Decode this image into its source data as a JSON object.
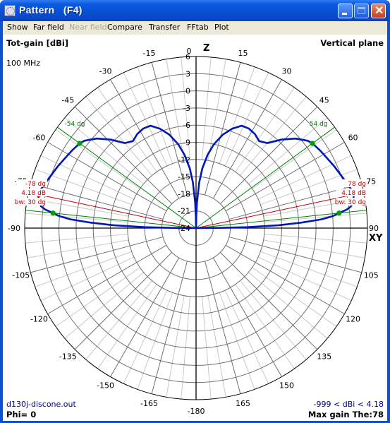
{
  "window": {
    "title": "Pattern   (F4)",
    "buttons": {
      "minimize": "minimize",
      "maximize": "maximize",
      "close": "close"
    }
  },
  "menu": [
    {
      "label": "Show",
      "enabled": true
    },
    {
      "label": "Far field",
      "enabled": true
    },
    {
      "label": "Near field",
      "enabled": false
    },
    {
      "label": "Compare",
      "enabled": true
    },
    {
      "label": "Transfer",
      "enabled": true
    },
    {
      "label": "FFtab",
      "enabled": true
    },
    {
      "label": "Plot",
      "enabled": true
    }
  ],
  "header": {
    "quantity": "Tot-gain [dBi]",
    "plane": "Vertical plane",
    "frequency": "100 MHz"
  },
  "footer": {
    "file": "d130j-discone.out",
    "phi": "Phi= 0",
    "range": "-999 < dBi < 4.18",
    "max_gain": "Max gain The:78"
  },
  "axis_labels": {
    "top": "Z",
    "right": "XY"
  },
  "colors": {
    "pattern": "#0018b8",
    "max_marker": "#e00000",
    "bw_marker": "#00a000",
    "max_line": "#c00000",
    "bw_line": "#008000"
  },
  "chart_data": {
    "type": "polar",
    "title": "Tot-gain [dBi]",
    "plane": "Vertical plane",
    "frequency": "100 MHz",
    "radial_range_dbi": [
      -24,
      6
    ],
    "radial_ticks": [
      6,
      3,
      0,
      -3,
      -6,
      -9,
      -12,
      -15,
      -18,
      -21,
      -24
    ],
    "angle_ticks": [
      0,
      15,
      30,
      45,
      60,
      75,
      90,
      105,
      120,
      135,
      150,
      165,
      180,
      -165,
      -150,
      -135,
      -120,
      -105,
      -90,
      -75,
      -60,
      -45,
      -30,
      -15
    ],
    "angle_tick_labels": {
      "0": "0",
      "15": "15",
      "30": "30",
      "45": "45",
      "60": "60",
      "75": "75",
      "90": "90",
      "105": "105",
      "120": "120",
      "135": "135",
      "150": "150",
      "165": "165",
      "180": "-180",
      "-15": "-15",
      "-30": "-30",
      "-45": "-45",
      "-60": "-60",
      "-75": "-75",
      "-90": "-90",
      "-105": "-105",
      "-120": "-120",
      "-135": "-135",
      "-150": "-150",
      "-165": "-165"
    },
    "series": [
      {
        "name": "Tot-gain",
        "theta_deg": [
          -90,
          -89.5,
          -89,
          -88,
          -87,
          -86,
          -85,
          -84,
          -83,
          -82,
          -80,
          -78,
          -76,
          -74,
          -72,
          -70,
          -66,
          -62,
          -58,
          -54,
          -52,
          -48,
          -44,
          -40,
          -36,
          -32,
          -28,
          -24,
          -20,
          -16,
          -12,
          -9,
          -6,
          -4,
          -2,
          -1,
          0,
          1,
          2,
          4,
          6,
          9,
          12,
          16,
          20,
          24,
          28,
          32,
          36,
          40,
          44,
          48,
          52,
          54,
          58,
          62,
          66,
          70,
          72,
          74,
          76,
          78,
          80,
          82,
          83,
          84,
          85,
          86,
          87,
          88,
          89,
          89.5,
          90
        ],
        "gain_dbi": [
          -24,
          -20,
          -15,
          -9.5,
          -5.5,
          -2,
          0,
          1.18,
          2.6,
          3.4,
          4.0,
          4.18,
          4.0,
          3.6,
          3.3,
          3.0,
          2.5,
          2.0,
          1.6,
          1.18,
          0.8,
          -0.6,
          -2.5,
          -4.6,
          -5.2,
          -4.6,
          -4.3,
          -4.4,
          -5.5,
          -7,
          -9,
          -11,
          -13.5,
          -16,
          -19.5,
          -22,
          -24,
          -22,
          -19.5,
          -16,
          -13.5,
          -11,
          -9,
          -7,
          -5.5,
          -4.4,
          -4.3,
          -4.6,
          -5.2,
          -4.6,
          -2.5,
          -0.6,
          0.8,
          1.18,
          1.6,
          2.0,
          2.5,
          3.0,
          3.3,
          3.6,
          4.0,
          4.18,
          4.0,
          3.4,
          2.6,
          1.18,
          0,
          -2,
          -5.5,
          -9.5,
          -15,
          -20,
          -24
        ]
      }
    ],
    "markers": [
      {
        "label": "78 dg",
        "theta_deg": 78,
        "gain_label": "4.18 dB",
        "bw_label": "bw: 30 dg",
        "type": "max"
      },
      {
        "label": "-78 dg",
        "theta_deg": -78,
        "gain_label": "4.18 dB",
        "bw_label": "bw: 30 dg",
        "type": "max"
      },
      {
        "label": "54 dg",
        "theta_deg": 54,
        "type": "bw"
      },
      {
        "label": "-54 dg",
        "theta_deg": -54,
        "type": "bw"
      },
      {
        "label": "",
        "theta_deg": 84,
        "type": "bw"
      },
      {
        "label": "",
        "theta_deg": -84,
        "type": "bw"
      }
    ],
    "max_gain_dbi": 4.18,
    "max_gain_theta_deg": 78,
    "beamwidth_deg": 30,
    "phi_deg": 0
  }
}
